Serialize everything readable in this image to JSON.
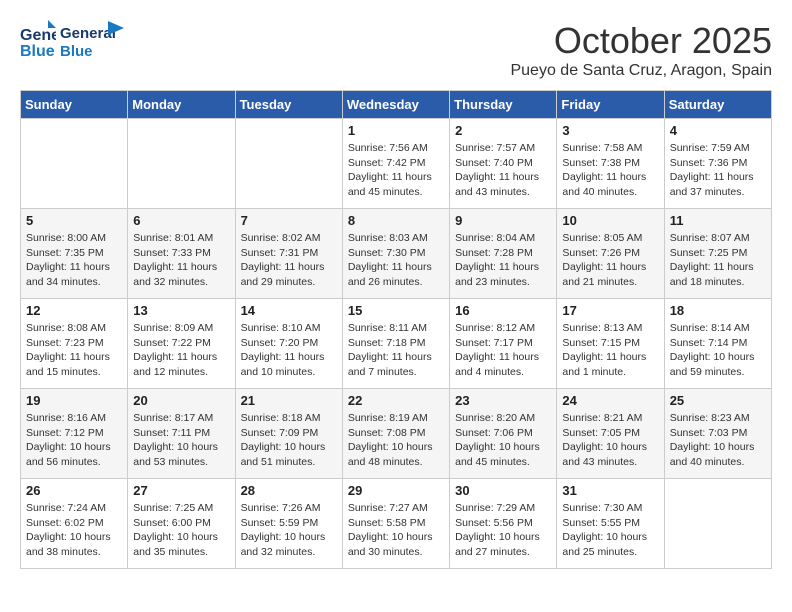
{
  "header": {
    "logo_line1": "General",
    "logo_line2": "Blue",
    "month": "October 2025",
    "location": "Pueyo de Santa Cruz, Aragon, Spain"
  },
  "days_of_week": [
    "Sunday",
    "Monday",
    "Tuesday",
    "Wednesday",
    "Thursday",
    "Friday",
    "Saturday"
  ],
  "weeks": [
    [
      {
        "day": "",
        "info": ""
      },
      {
        "day": "",
        "info": ""
      },
      {
        "day": "",
        "info": ""
      },
      {
        "day": "1",
        "info": "Sunrise: 7:56 AM\nSunset: 7:42 PM\nDaylight: 11 hours\nand 45 minutes."
      },
      {
        "day": "2",
        "info": "Sunrise: 7:57 AM\nSunset: 7:40 PM\nDaylight: 11 hours\nand 43 minutes."
      },
      {
        "day": "3",
        "info": "Sunrise: 7:58 AM\nSunset: 7:38 PM\nDaylight: 11 hours\nand 40 minutes."
      },
      {
        "day": "4",
        "info": "Sunrise: 7:59 AM\nSunset: 7:36 PM\nDaylight: 11 hours\nand 37 minutes."
      }
    ],
    [
      {
        "day": "5",
        "info": "Sunrise: 8:00 AM\nSunset: 7:35 PM\nDaylight: 11 hours\nand 34 minutes."
      },
      {
        "day": "6",
        "info": "Sunrise: 8:01 AM\nSunset: 7:33 PM\nDaylight: 11 hours\nand 32 minutes."
      },
      {
        "day": "7",
        "info": "Sunrise: 8:02 AM\nSunset: 7:31 PM\nDaylight: 11 hours\nand 29 minutes."
      },
      {
        "day": "8",
        "info": "Sunrise: 8:03 AM\nSunset: 7:30 PM\nDaylight: 11 hours\nand 26 minutes."
      },
      {
        "day": "9",
        "info": "Sunrise: 8:04 AM\nSunset: 7:28 PM\nDaylight: 11 hours\nand 23 minutes."
      },
      {
        "day": "10",
        "info": "Sunrise: 8:05 AM\nSunset: 7:26 PM\nDaylight: 11 hours\nand 21 minutes."
      },
      {
        "day": "11",
        "info": "Sunrise: 8:07 AM\nSunset: 7:25 PM\nDaylight: 11 hours\nand 18 minutes."
      }
    ],
    [
      {
        "day": "12",
        "info": "Sunrise: 8:08 AM\nSunset: 7:23 PM\nDaylight: 11 hours\nand 15 minutes."
      },
      {
        "day": "13",
        "info": "Sunrise: 8:09 AM\nSunset: 7:22 PM\nDaylight: 11 hours\nand 12 minutes."
      },
      {
        "day": "14",
        "info": "Sunrise: 8:10 AM\nSunset: 7:20 PM\nDaylight: 11 hours\nand 10 minutes."
      },
      {
        "day": "15",
        "info": "Sunrise: 8:11 AM\nSunset: 7:18 PM\nDaylight: 11 hours\nand 7 minutes."
      },
      {
        "day": "16",
        "info": "Sunrise: 8:12 AM\nSunset: 7:17 PM\nDaylight: 11 hours\nand 4 minutes."
      },
      {
        "day": "17",
        "info": "Sunrise: 8:13 AM\nSunset: 7:15 PM\nDaylight: 11 hours\nand 1 minute."
      },
      {
        "day": "18",
        "info": "Sunrise: 8:14 AM\nSunset: 7:14 PM\nDaylight: 10 hours\nand 59 minutes."
      }
    ],
    [
      {
        "day": "19",
        "info": "Sunrise: 8:16 AM\nSunset: 7:12 PM\nDaylight: 10 hours\nand 56 minutes."
      },
      {
        "day": "20",
        "info": "Sunrise: 8:17 AM\nSunset: 7:11 PM\nDaylight: 10 hours\nand 53 minutes."
      },
      {
        "day": "21",
        "info": "Sunrise: 8:18 AM\nSunset: 7:09 PM\nDaylight: 10 hours\nand 51 minutes."
      },
      {
        "day": "22",
        "info": "Sunrise: 8:19 AM\nSunset: 7:08 PM\nDaylight: 10 hours\nand 48 minutes."
      },
      {
        "day": "23",
        "info": "Sunrise: 8:20 AM\nSunset: 7:06 PM\nDaylight: 10 hours\nand 45 minutes."
      },
      {
        "day": "24",
        "info": "Sunrise: 8:21 AM\nSunset: 7:05 PM\nDaylight: 10 hours\nand 43 minutes."
      },
      {
        "day": "25",
        "info": "Sunrise: 8:23 AM\nSunset: 7:03 PM\nDaylight: 10 hours\nand 40 minutes."
      }
    ],
    [
      {
        "day": "26",
        "info": "Sunrise: 7:24 AM\nSunset: 6:02 PM\nDaylight: 10 hours\nand 38 minutes."
      },
      {
        "day": "27",
        "info": "Sunrise: 7:25 AM\nSunset: 6:00 PM\nDaylight: 10 hours\nand 35 minutes."
      },
      {
        "day": "28",
        "info": "Sunrise: 7:26 AM\nSunset: 5:59 PM\nDaylight: 10 hours\nand 32 minutes."
      },
      {
        "day": "29",
        "info": "Sunrise: 7:27 AM\nSunset: 5:58 PM\nDaylight: 10 hours\nand 30 minutes."
      },
      {
        "day": "30",
        "info": "Sunrise: 7:29 AM\nSunset: 5:56 PM\nDaylight: 10 hours\nand 27 minutes."
      },
      {
        "day": "31",
        "info": "Sunrise: 7:30 AM\nSunset: 5:55 PM\nDaylight: 10 hours\nand 25 minutes."
      },
      {
        "day": "",
        "info": ""
      }
    ]
  ]
}
